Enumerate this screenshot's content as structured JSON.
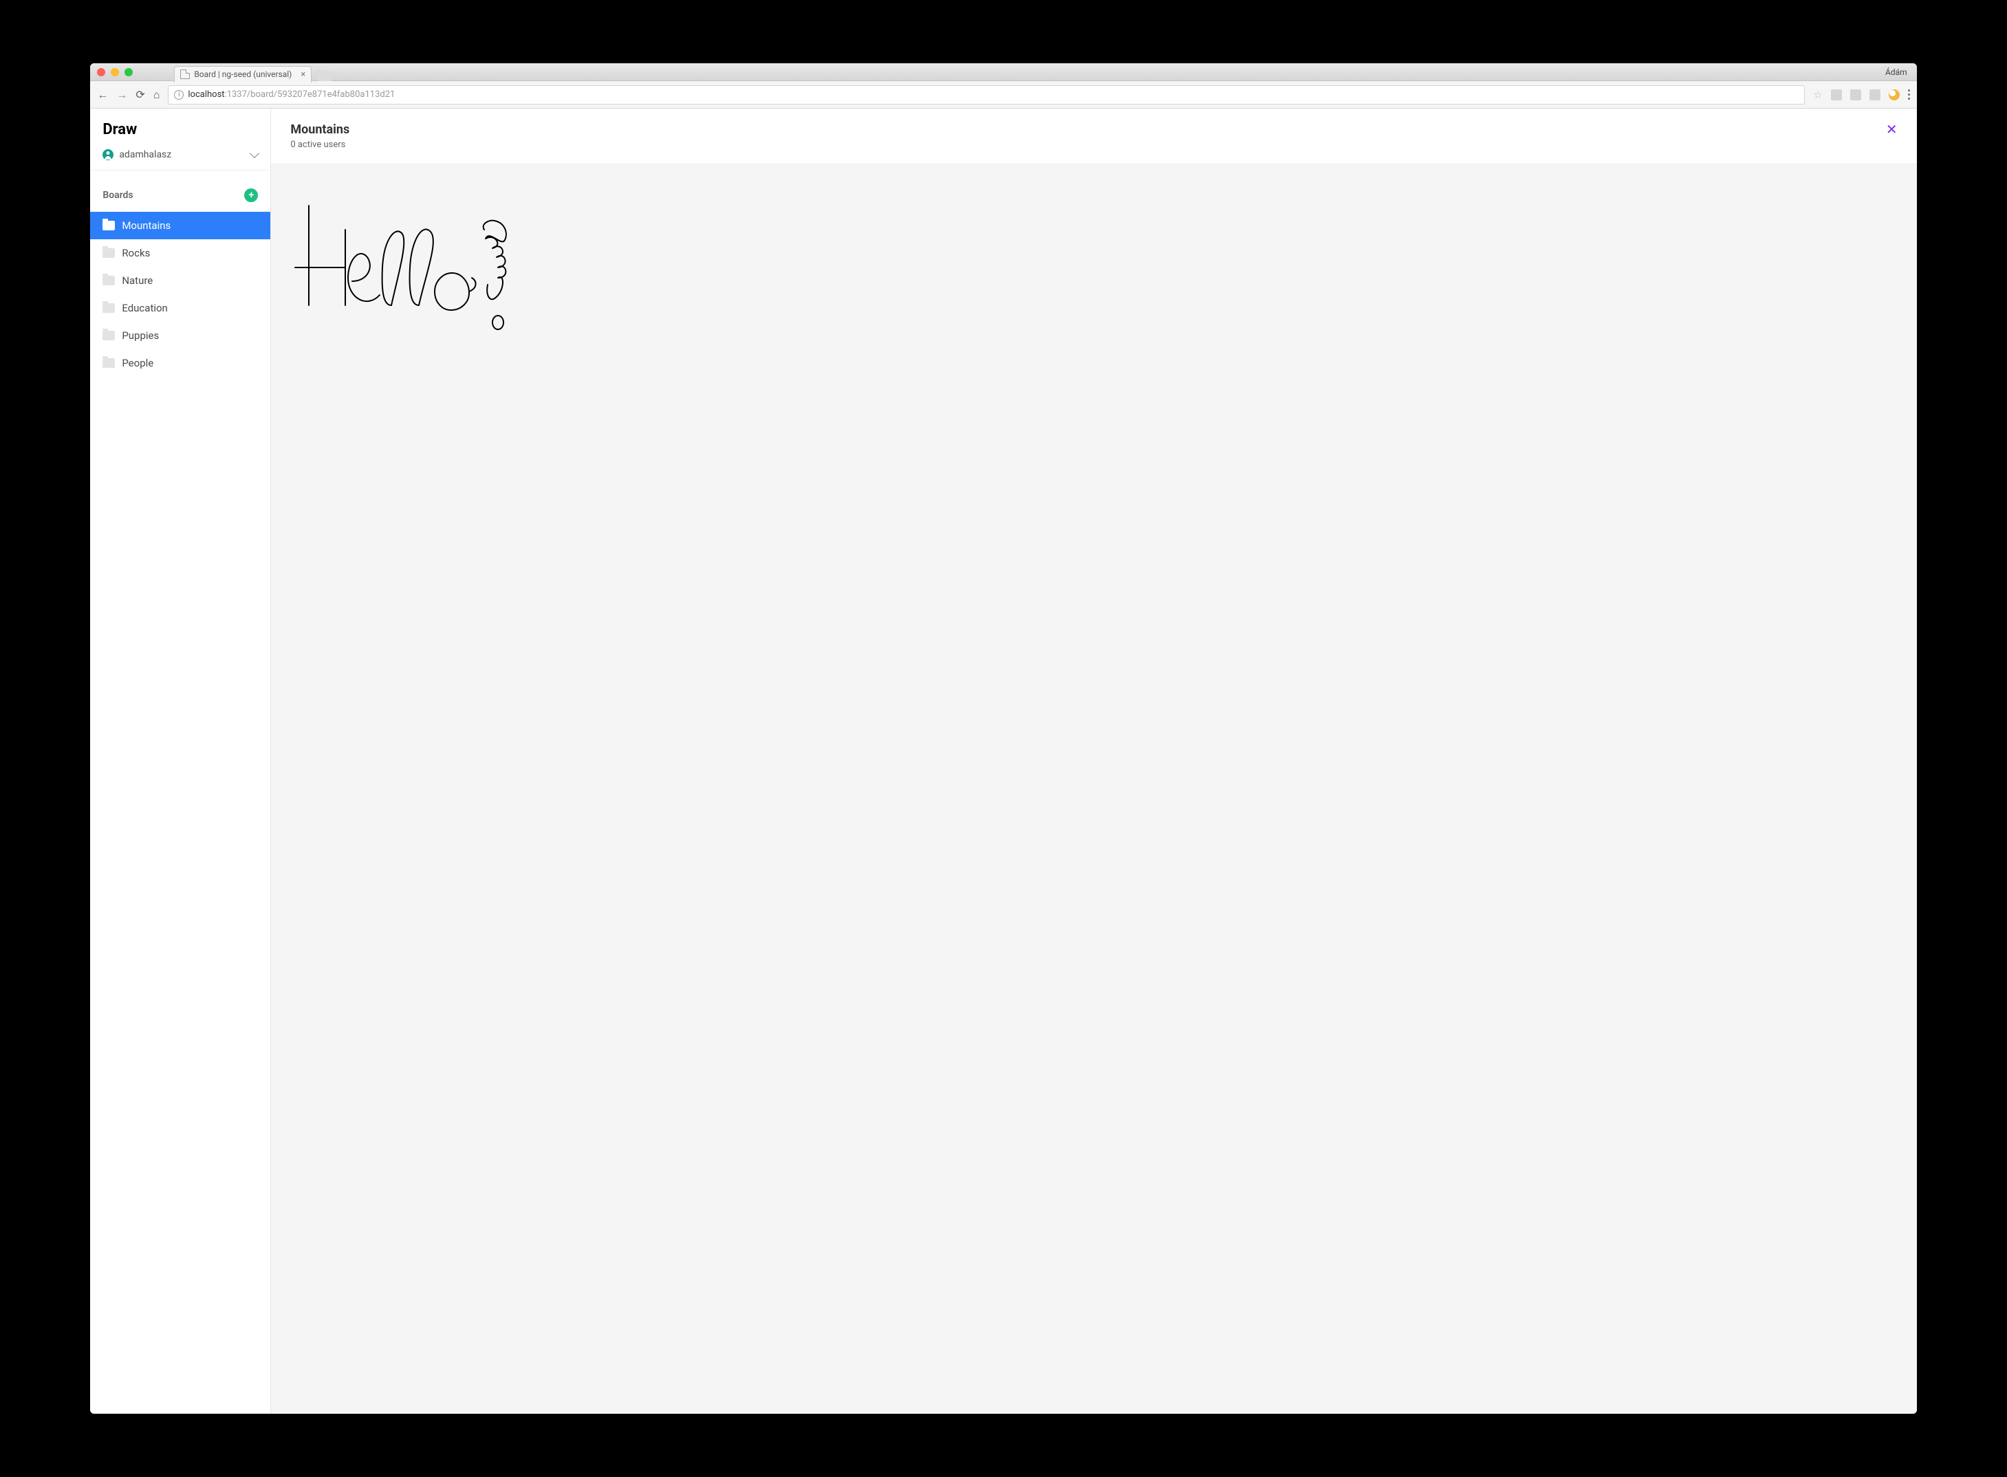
{
  "browser": {
    "tab_title": "Board | ng-seed (universal)",
    "profile_name": "Ádám",
    "url_host": "localhost",
    "url_rest": ":1337/board/593207e871e4fab80a113d21"
  },
  "app": {
    "title": "Draw",
    "username": "adamhalasz",
    "section_label": "Boards",
    "boards": [
      {
        "label": "Mountains",
        "active": true
      },
      {
        "label": "Rocks",
        "active": false
      },
      {
        "label": "Nature",
        "active": false
      },
      {
        "label": "Education",
        "active": false
      },
      {
        "label": "Puppies",
        "active": false
      },
      {
        "label": "People",
        "active": false
      }
    ],
    "current_board": {
      "title": "Mountains",
      "subtitle": "0 active users"
    }
  }
}
